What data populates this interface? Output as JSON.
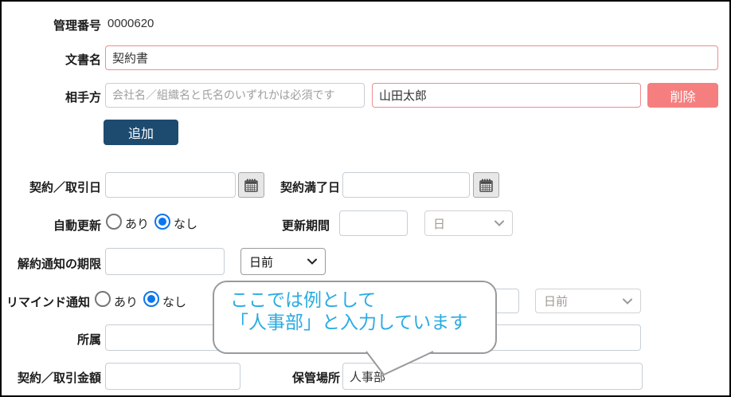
{
  "colors": {
    "error_border": "#ed8d8d",
    "delete_button_bg": "#f57f7f",
    "add_button_bg": "#1d4b70",
    "radio_selected": "#0b76ef",
    "callout_text": "#29abe2",
    "panel_border": "#000000"
  },
  "form": {
    "management_number": {
      "label": "管理番号",
      "value": "0000620"
    },
    "document_name": {
      "label": "文書名",
      "value": "契約書"
    },
    "counterparty": {
      "label": "相手方",
      "company_placeholder": "会社名／組織名と氏名のいずれかは必須です",
      "person_value": "山田太郎",
      "delete_button": "削除",
      "add_button": "追加"
    },
    "contract_date": {
      "label": "契約／取引日",
      "value": ""
    },
    "contract_expiry": {
      "label": "契約満了日",
      "value": ""
    },
    "auto_renewal": {
      "label": "自動更新",
      "options": [
        {
          "label": "あり",
          "selected": false
        },
        {
          "label": "なし",
          "selected": true
        }
      ]
    },
    "renewal_period": {
      "label": "更新期間",
      "value": "",
      "unit": "日"
    },
    "cancel_notice": {
      "label": "解約通知の期限",
      "value": "",
      "unit": "日前"
    },
    "reminder": {
      "label": "リマインド通知",
      "options": [
        {
          "label": "あり",
          "selected": false
        },
        {
          "label": "なし",
          "selected": true
        }
      ],
      "value": "",
      "unit": "日前"
    },
    "department": {
      "label": "所属",
      "value": ""
    },
    "contract_amount": {
      "label": "契約／取引金額",
      "value": ""
    },
    "storage_location": {
      "label": "保管場所",
      "value": "人事部"
    }
  },
  "callout": {
    "line1": "ここでは例として",
    "line2": "「人事部」と入力しています"
  }
}
